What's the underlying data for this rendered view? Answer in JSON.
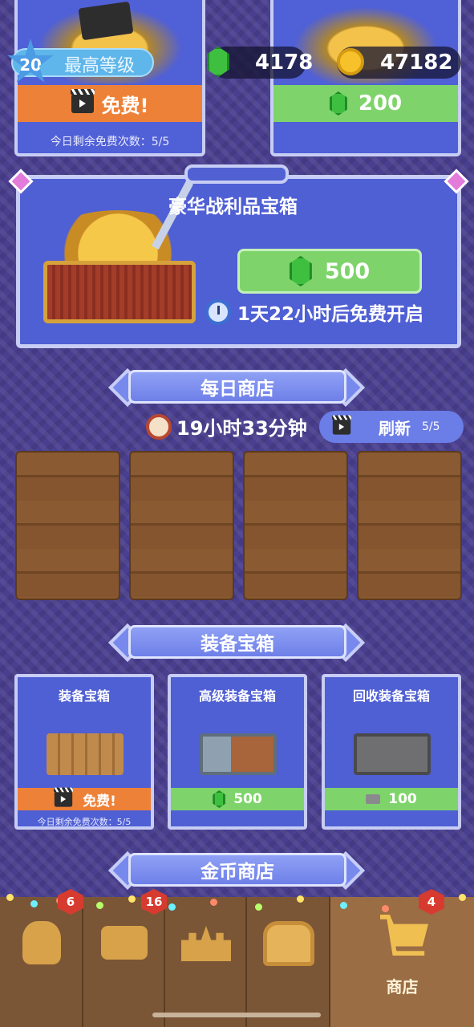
{
  "top_cards": {
    "left": {
      "cta_label": "免费!",
      "free_uses_note": "今日剩余免费次数：5/5"
    },
    "right": {
      "price": "200"
    }
  },
  "status_bar": {
    "level": "20",
    "level_label": "最高等级",
    "gems": "4178",
    "coins": "47182"
  },
  "luxury_chest": {
    "title": "豪华战利品宝箱",
    "price": "500",
    "free_timer": "1天22小时后免费开启"
  },
  "daily_shop": {
    "title": "每日商店",
    "timer": "19小时33分钟",
    "refresh_label": "刷新",
    "refresh_count": "5/5"
  },
  "equipment_section": {
    "title": "装备宝箱",
    "cards": [
      {
        "title": "装备宝箱",
        "cta": "免费!",
        "note": "今日剩余免费次数：5/5"
      },
      {
        "title": "高级装备宝箱",
        "price": "500"
      },
      {
        "title": "回收装备宝箱",
        "price": "100"
      }
    ]
  },
  "coin_shop": {
    "title": "金币商店"
  },
  "bottom_nav": {
    "items": [
      {
        "icon": "hero-icon",
        "badge": "6"
      },
      {
        "icon": "army-icon",
        "badge": "16"
      },
      {
        "icon": "castle-icon"
      },
      {
        "icon": "chest-icon"
      },
      {
        "icon": "cart-icon",
        "label": "商店",
        "badge": "4"
      }
    ]
  },
  "colors": {
    "background": "#4a3f8f",
    "card": "#4f5fd4",
    "green_button": "#7ed46a",
    "orange_button": "#ee8138",
    "wood": "#8a5a32"
  }
}
